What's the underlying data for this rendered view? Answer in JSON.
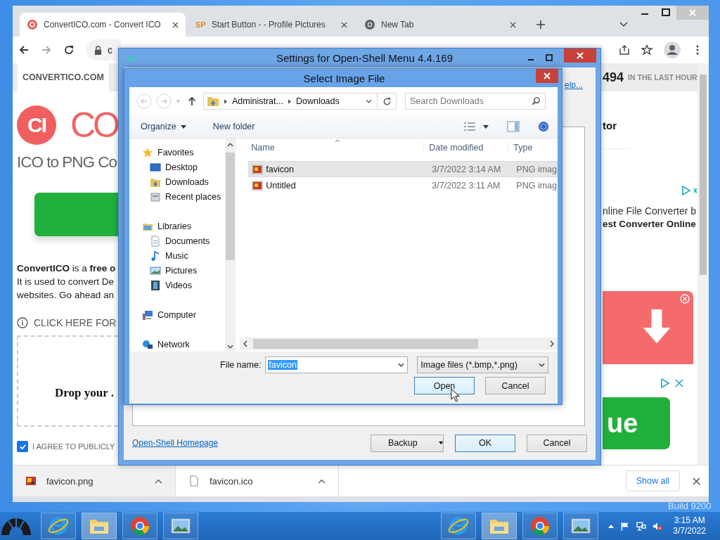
{
  "browser": {
    "tabs": [
      {
        "title": "ConvertICO.com - Convert ICO",
        "selected": true,
        "kind": "site"
      },
      {
        "title": "Start Button - - Profile Pictures",
        "selected": false,
        "kind": "badge",
        "badge": "SP"
      },
      {
        "title": "New Tab",
        "selected": false,
        "kind": "chrome"
      }
    ],
    "address": "c",
    "page": {
      "site_tab": "CONVERTICO.COM",
      "counter": "494",
      "counter_label": "IN THE LAST HOUR",
      "logo_badge": "CI",
      "logo_text": "CO",
      "subtitle": "ICO to PNG Co",
      "intro": [
        "**ConvertICO** is a **free o**",
        "It is used to convert De",
        "websites. Go ahead an"
      ],
      "info": "CLICK HERE FOR",
      "drop_text": "Drop your .",
      "agree": {
        "label": "I AGREE TO PUBLICLY",
        "checked": true
      },
      "side_heading": "tor",
      "ad_line": "nline File Converter b",
      "ad_title": "est Converter Online",
      "green_ad_text": "ue"
    },
    "downloads": {
      "items": [
        {
          "name": "favicon.png",
          "kind": "image"
        },
        {
          "name": "favicon.ico",
          "kind": "file"
        }
      ],
      "show_all": "Show all"
    }
  },
  "settings_dialog": {
    "title": "Settings for Open-Shell Menu 4.4.169",
    "help_link": "elp...",
    "homepage_link": "Open-Shell Homepage",
    "buttons": [
      {
        "label": "Backup",
        "kind": "split"
      },
      {
        "label": "OK",
        "kind": "default"
      },
      {
        "label": "Cancel",
        "kind": "plain"
      }
    ]
  },
  "file_dialog": {
    "title": "Select Image File",
    "path": [
      "Administrat...",
      "Downloads"
    ],
    "search": {
      "placeholder": "Search Downloads"
    },
    "toolbar": [
      {
        "label": "Organize",
        "kind": "menu"
      },
      {
        "label": "New folder",
        "kind": "plain"
      }
    ],
    "nav": [
      {
        "label": "Favorites",
        "kind": "star",
        "children": [
          {
            "label": "Desktop",
            "kind": "desktop"
          },
          {
            "label": "Downloads",
            "kind": "downloads"
          },
          {
            "label": "Recent places",
            "kind": "recent"
          }
        ]
      },
      {
        "label": "Libraries",
        "kind": "library",
        "children": [
          {
            "label": "Documents",
            "kind": "documents"
          },
          {
            "label": "Music",
            "kind": "music"
          },
          {
            "label": "Pictures",
            "kind": "pictures"
          },
          {
            "label": "Videos",
            "kind": "videos"
          }
        ]
      },
      {
        "label": "Computer",
        "kind": "computer"
      },
      {
        "label": "Network",
        "kind": "network"
      }
    ],
    "columns": [
      "Name",
      "Date modified",
      "Type"
    ],
    "rows": [
      {
        "name": "favicon",
        "date": "3/7/2022 3:14 AM",
        "type": "PNG imag",
        "selected": true
      },
      {
        "name": "Untitled",
        "date": "3/7/2022 3:11 AM",
        "type": "PNG imag",
        "selected": false
      }
    ],
    "file_name_label": "File name:",
    "file_name": "favicon",
    "file_type": "Image files (*.bmp,*.png)",
    "buttons": [
      {
        "label": "Open",
        "kind": "default"
      },
      {
        "label": "Cancel",
        "kind": "plain"
      }
    ]
  },
  "desktop_text": "Build 9200",
  "taskbar": {
    "left_apps": [
      {
        "kind": "ie",
        "highlighted": false
      },
      {
        "kind": "explorer",
        "highlighted": true
      },
      {
        "kind": "chrome",
        "highlighted": false
      },
      {
        "kind": "photos",
        "highlighted": false
      }
    ],
    "right_apps": [
      {
        "kind": "ie",
        "highlighted": false
      },
      {
        "kind": "explorer",
        "highlighted": true
      },
      {
        "kind": "chrome",
        "highlighted": false
      },
      {
        "kind": "photos",
        "highlighted": false
      }
    ],
    "clock": {
      "time": "3:15 AM",
      "date": "3/7/2022"
    }
  }
}
